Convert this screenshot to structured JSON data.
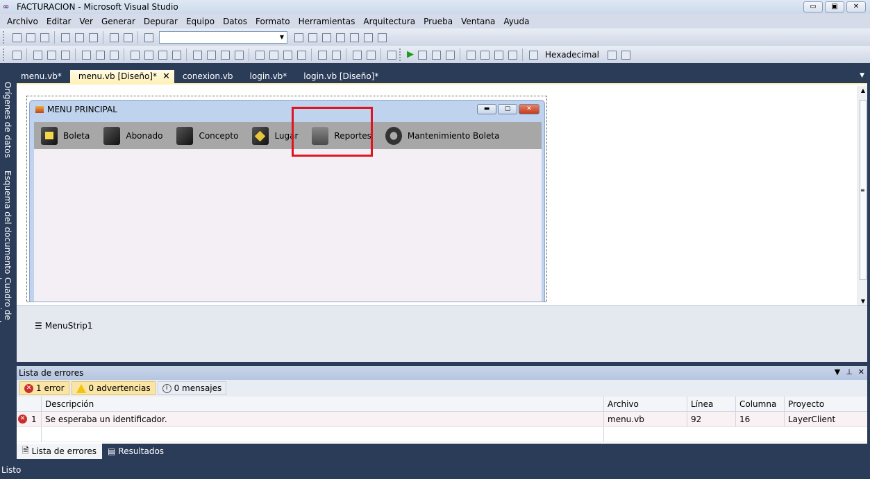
{
  "window": {
    "title": "FACTURACION - Microsoft Visual Studio",
    "logo": "vs-infinity-icon",
    "controls": [
      "▭",
      "▣",
      "✕"
    ]
  },
  "menubar": [
    "Archivo",
    "Editar",
    "Ver",
    "Generar",
    "Depurar",
    "Equipo",
    "Datos",
    "Formato",
    "Herramientas",
    "Arquitectura",
    "Prueba",
    "Ventana",
    "Ayuda"
  ],
  "toolbar2": {
    "hex_label": "Hexadecimal"
  },
  "side_tabs": [
    "Orígenes de datos",
    "Esquema del documento",
    "Cuadro de herramientas"
  ],
  "doc_tabs": [
    {
      "label": "menu.vb*",
      "active": false
    },
    {
      "label": "menu.vb [Diseño]*",
      "active": true
    },
    {
      "label": "conexion.vb",
      "active": false
    },
    {
      "label": "login.vb*",
      "active": false
    },
    {
      "label": "login.vb [Diseño]*",
      "active": false
    }
  ],
  "form": {
    "title": "MENU PRINCIPAL",
    "menu_items": [
      {
        "label": "Boleta",
        "icon": "folder-note-icon"
      },
      {
        "label": "Abonado",
        "icon": "user-folder-icon"
      },
      {
        "label": "Concepto",
        "icon": "film-folder-icon"
      },
      {
        "label": "Lugar",
        "icon": "sign-folder-icon"
      },
      {
        "label": "Reportes",
        "icon": "reports-icon"
      },
      {
        "label": "Mantenimiento Boleta",
        "icon": "gear-folder-icon"
      }
    ],
    "highlight_color": "#e0141e"
  },
  "tray": {
    "component": "MenuStrip1"
  },
  "error_list": {
    "title": "Lista de errores",
    "filters": {
      "errors": "1 error",
      "warnings": "0 advertencias",
      "messages": "0 mensajes"
    },
    "columns": [
      "",
      "Descripción",
      "Archivo",
      "Línea",
      "Columna",
      "Proyecto"
    ],
    "rows": [
      {
        "num": "1",
        "description": "Se esperaba un identificador.",
        "file": "menu.vb",
        "line": "92",
        "column": "16",
        "project": "LayerClient"
      }
    ],
    "tabs": [
      "Lista de errores",
      "Resultados"
    ]
  },
  "status": "Listo",
  "colors": {
    "chrome": "#2b3c59",
    "active_tab": "#fff1b8",
    "menustrip": "#a7a7a7"
  }
}
